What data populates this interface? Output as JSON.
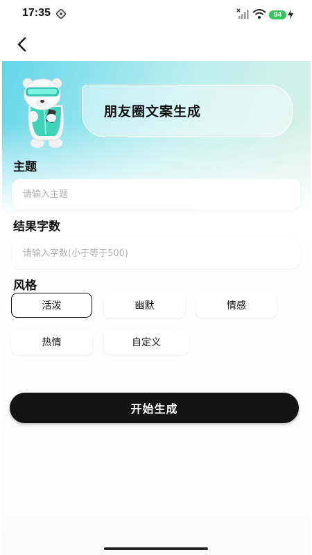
{
  "status_bar": {
    "time": "17:35",
    "battery_level": "94",
    "battery_color": "#34c759",
    "icons": [
      "nfc-icon",
      "signal-icon",
      "wifi-icon",
      "charging-bolt-icon"
    ]
  },
  "nav": {
    "back_icon": "chevron-left-icon"
  },
  "header": {
    "title": "朋友圈文案生成",
    "mascot": "polar-bear-mascot"
  },
  "form": {
    "topic": {
      "label": "主题",
      "placeholder": "请输入主题",
      "value": ""
    },
    "word_count": {
      "label": "结果字数",
      "placeholder": "请输入字数(小于等于500)",
      "value": ""
    },
    "style": {
      "label": "风格",
      "options": [
        "活泼",
        "幽默",
        "情感",
        "热情",
        "自定义"
      ],
      "selected": "活泼"
    }
  },
  "actions": {
    "start_label": "开始生成"
  },
  "colors": {
    "accent": "#141414",
    "gradient_start": "#62d6e9",
    "gradient_end": "#bfe3ff"
  }
}
